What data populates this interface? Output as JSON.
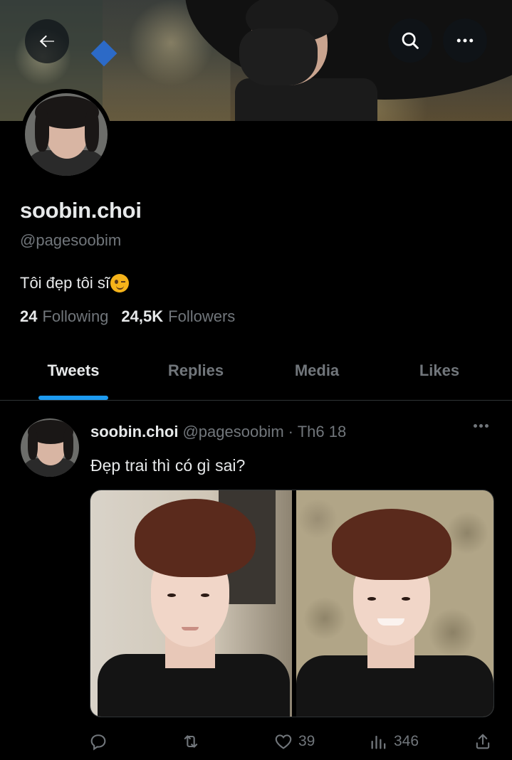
{
  "profile": {
    "display_name": "soobin.choi",
    "handle": "@pagesoobim",
    "bio_text": "Tôi đẹp tôi sĩ",
    "bio_emoji": "winking-face-emoji",
    "following_count": "24",
    "following_label": "Following",
    "followers_count": "24,5K",
    "followers_label": "Followers"
  },
  "tabs": [
    {
      "label": "Tweets",
      "active": true
    },
    {
      "label": "Replies",
      "active": false
    },
    {
      "label": "Media",
      "active": false
    },
    {
      "label": "Likes",
      "active": false
    }
  ],
  "tweet": {
    "author_name": "soobin.choi",
    "author_handle": "@pagesoobim",
    "timestamp": "· Th6 18",
    "text": "Đẹp trai thì có gì sai?",
    "reply_count": "",
    "retweet_count": "",
    "like_count": "39",
    "view_count": "346"
  },
  "icons": {
    "back": "back-arrow-icon",
    "search": "search-icon",
    "more": "more-icon",
    "reply": "reply-icon",
    "retweet": "retweet-icon",
    "like": "heart-icon",
    "views": "views-icon",
    "share": "share-icon"
  },
  "colors": {
    "background": "#000000",
    "accent": "#1d9bf0",
    "primary_text": "#e7e9ea",
    "secondary_text": "#71767b",
    "divider": "#2f3336"
  }
}
